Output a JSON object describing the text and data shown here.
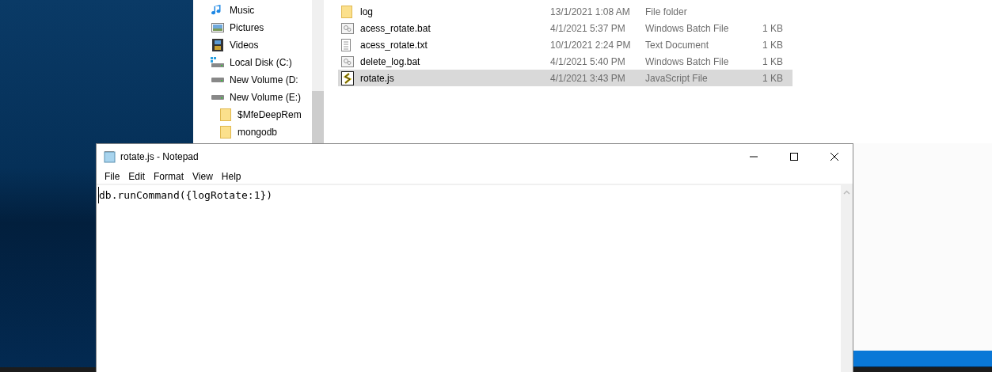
{
  "explorer": {
    "nav_items": [
      {
        "label": "Music",
        "kind": "music"
      },
      {
        "label": "Pictures",
        "kind": "pictures"
      },
      {
        "label": "Videos",
        "kind": "videos"
      },
      {
        "label": "Local Disk (C:)",
        "kind": "system-disk"
      },
      {
        "label": "New Volume (D:",
        "kind": "drive"
      },
      {
        "label": "New Volume (E:)",
        "kind": "drive",
        "children": [
          {
            "label": "$MfeDeepRem",
            "kind": "folder"
          },
          {
            "label": "mongodb",
            "kind": "folder"
          }
        ]
      }
    ],
    "files": [
      {
        "name": "log",
        "column_2": "13/1/2021 1:08 AM",
        "column_3": "File folder",
        "kind": "folder",
        "selected": false
      },
      {
        "name": "acess_rotate.bat",
        "column_2": "4/1/2021 5:37 PM",
        "column_3": "Windows Batch File",
        "column_4": "1 KB",
        "kind": "batch",
        "selected": false
      },
      {
        "name": "acess_rotate.txt",
        "column_2": "10/1/2021 2:24 PM",
        "column_3": "Text Document",
        "column_4": "1 KB",
        "kind": "text",
        "selected": false
      },
      {
        "name": "delete_log.bat",
        "column_2": "4/1/2021 5:40 PM",
        "column_3": "Windows Batch File",
        "column_4": "1 KB",
        "kind": "batch",
        "selected": false
      },
      {
        "name": "rotate.js",
        "column_2": "4/1/2021 3:43 PM",
        "column_3": "JavaScript File",
        "column_4": "1 KB",
        "kind": "script",
        "selected": true
      }
    ]
  },
  "notepad": {
    "title": "rotate.js - Notepad",
    "menu": [
      "File",
      "Edit",
      "Format",
      "View",
      "Help"
    ],
    "text": "db.runCommand({logRotate:1})"
  }
}
